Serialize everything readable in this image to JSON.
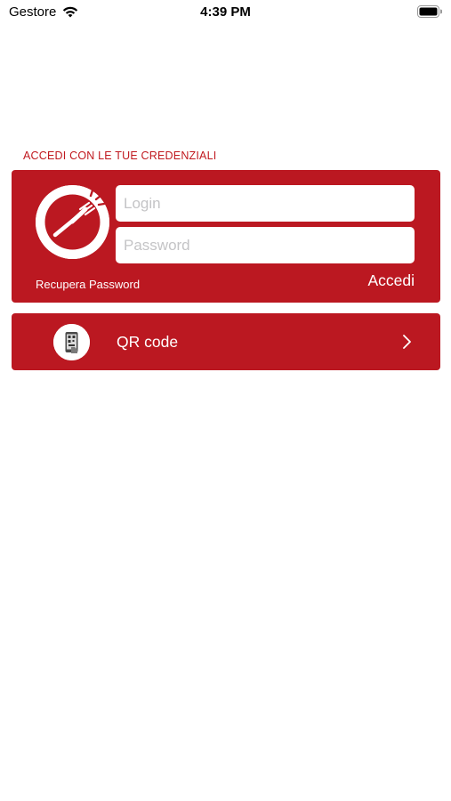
{
  "status_bar": {
    "carrier": "Gestore",
    "time": "4:39 PM",
    "icons": [
      "wifi-icon",
      "battery-icon"
    ]
  },
  "login_section": {
    "title": "ACCEDI CON LE TUE CREDENZIALI",
    "login_placeholder": "Login",
    "login_value": "",
    "password_placeholder": "Password",
    "password_value": "",
    "recover_label": "Recupera Password",
    "submit_label": "Accedi",
    "logo_icon": "fork-plate-logo-icon"
  },
  "qr_section": {
    "label": "QR code",
    "icon": "qr-phone-icon",
    "chevron": "chevron-right-icon"
  },
  "colors": {
    "brand_red": "#bb1821",
    "title_red": "#c0191f",
    "placeholder": "#c4c4c6"
  }
}
